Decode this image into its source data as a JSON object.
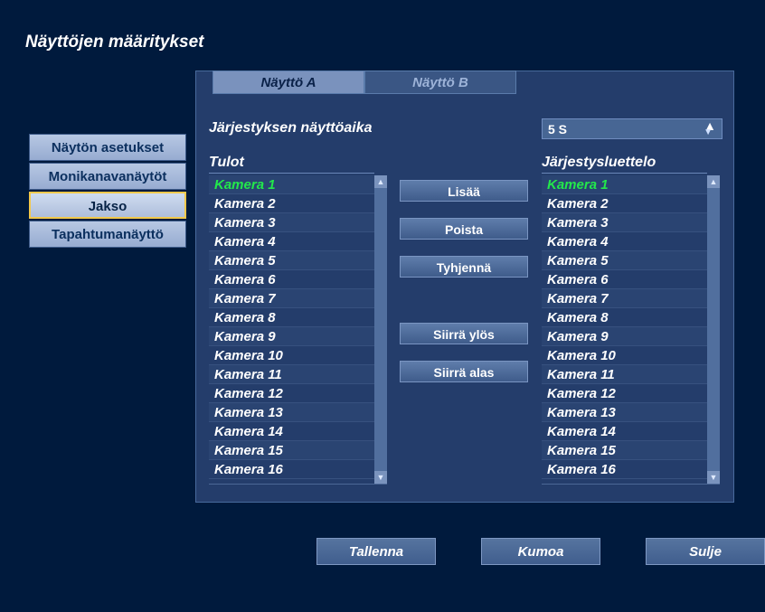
{
  "title": "Näyttöjen määritykset",
  "sideNav": {
    "items": [
      {
        "label": "Näytön asetukset"
      },
      {
        "label": "Monikanavanäytöt"
      },
      {
        "label": "Jakso"
      },
      {
        "label": "Tapahtumanäyttö"
      }
    ],
    "activeIndex": 2
  },
  "tabs": {
    "a": "Näyttö A",
    "b": "Näyttö B",
    "activeIndex": 0
  },
  "sequence": {
    "label": "Järjestyksen näyttöaika",
    "value": "5 S"
  },
  "columns": {
    "inputsTitle": "Tulot",
    "sequenceTitle": "Järjestysluettelo"
  },
  "inputs": {
    "selectedIndex": 0,
    "items": [
      "Kamera 1",
      "Kamera 2",
      "Kamera 3",
      "Kamera 4",
      "Kamera 5",
      "Kamera 6",
      "Kamera 7",
      "Kamera 8",
      "Kamera 9",
      "Kamera 10",
      "Kamera 11",
      "Kamera 12",
      "Kamera 13",
      "Kamera 14",
      "Kamera 15",
      "Kamera 16"
    ]
  },
  "sequenceList": {
    "selectedIndex": 0,
    "items": [
      "Kamera 1",
      "Kamera 2",
      "Kamera 3",
      "Kamera 4",
      "Kamera 5",
      "Kamera 6",
      "Kamera 7",
      "Kamera 8",
      "Kamera 9",
      "Kamera 10",
      "Kamera 11",
      "Kamera 12",
      "Kamera 13",
      "Kamera 14",
      "Kamera 15",
      "Kamera 16"
    ]
  },
  "buttons": {
    "add": "Lisää",
    "remove": "Poista",
    "clear": "Tyhjennä",
    "moveUp": "Siirrä ylös",
    "moveDown": "Siirrä alas"
  },
  "footer": {
    "save": "Tallenna",
    "undo": "Kumoa",
    "close": "Sulje"
  }
}
